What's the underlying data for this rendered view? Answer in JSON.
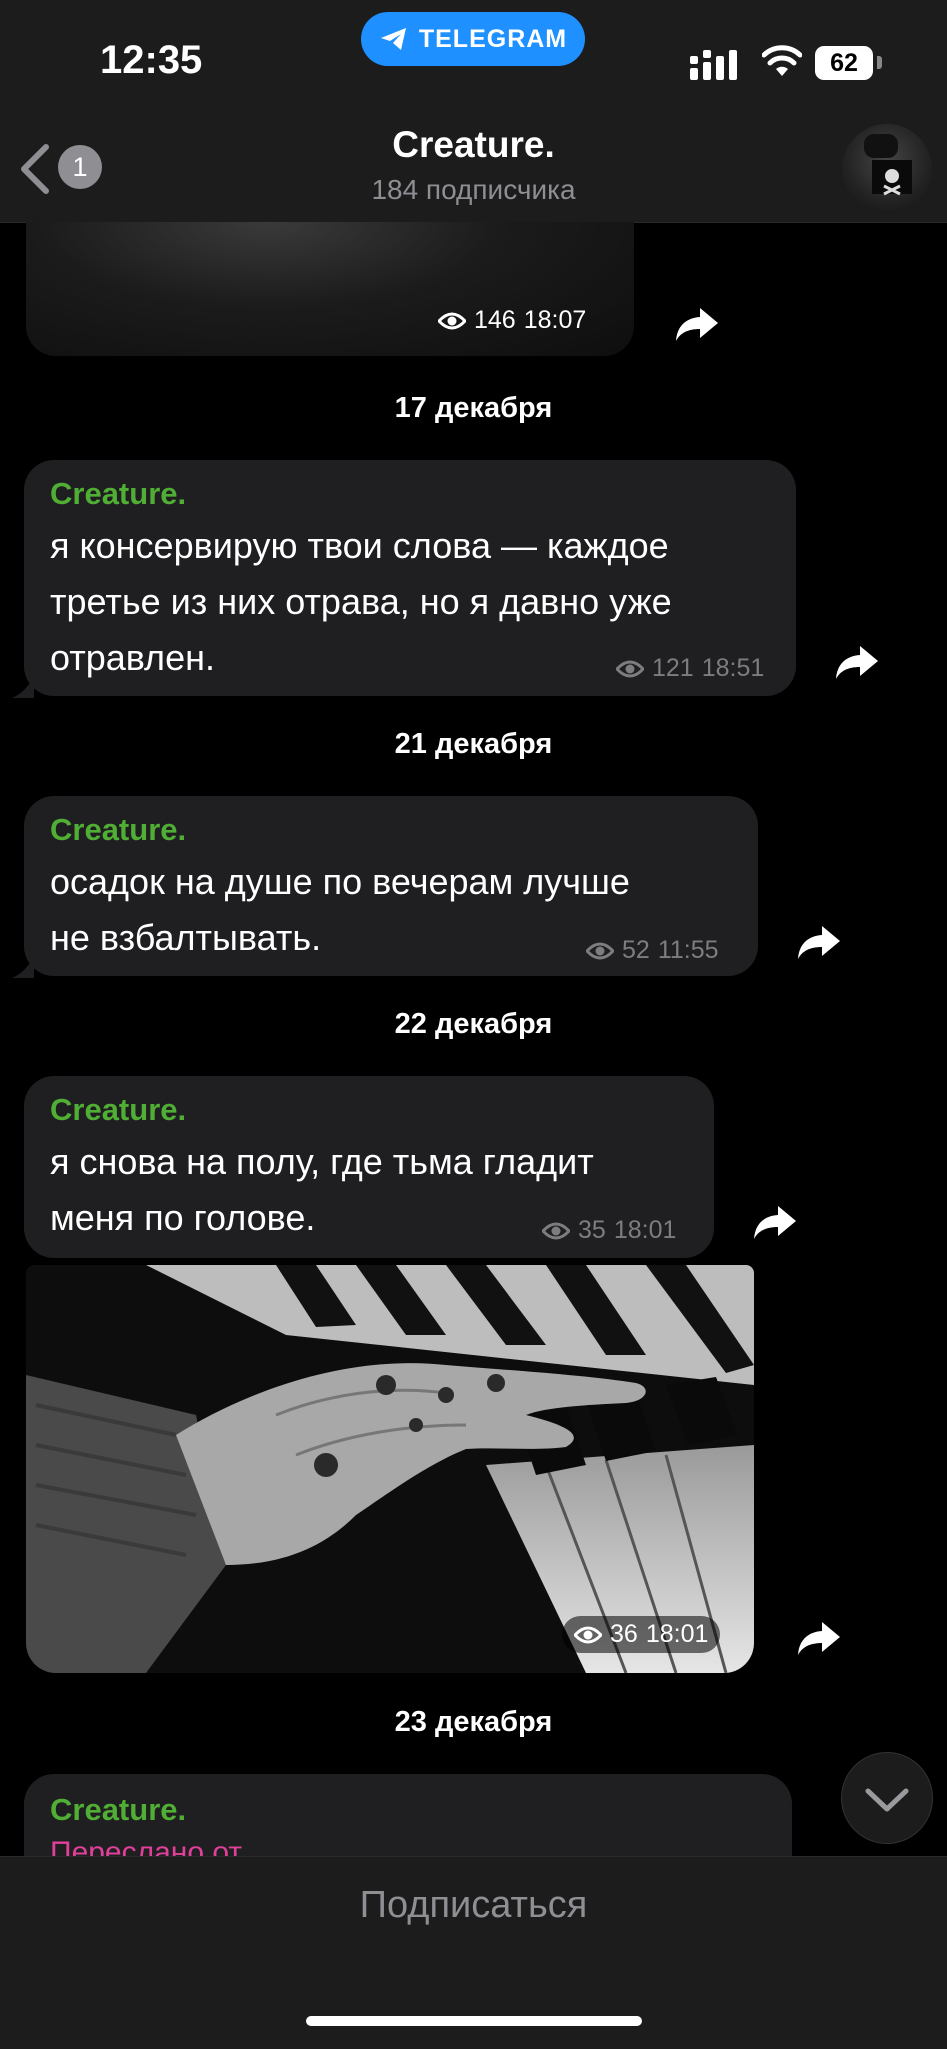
{
  "status_bar": {
    "time": "12:35",
    "app_pill": "TELEGRAM",
    "battery": "62"
  },
  "header": {
    "back_count": "1",
    "title": "Creature.",
    "subtitle": "184 подписчика"
  },
  "messages": [
    {
      "id": "m0",
      "type": "photo",
      "views": "146",
      "time": "18:07"
    },
    {
      "id": "d1",
      "type": "date",
      "text": "17 декабря"
    },
    {
      "id": "m1",
      "type": "text",
      "author": "Creature.",
      "lines": [
        "я консервирую твои слова — каждое",
        "третье из них отрава, но я давно уже",
        "отравлен."
      ],
      "views": "121",
      "time": "18:51"
    },
    {
      "id": "d2",
      "type": "date",
      "text": "21 декабря"
    },
    {
      "id": "m2",
      "type": "text",
      "author": "Creature.",
      "lines": [
        "осадок на душе по вечерам лучше",
        "не взбалтывать."
      ],
      "views": "52",
      "time": "11:55"
    },
    {
      "id": "d3",
      "type": "date",
      "text": "22 декабря"
    },
    {
      "id": "m3",
      "type": "text",
      "author": "Creature.",
      "lines": [
        "я снова на полу, где тьма гладит",
        "меня по голове."
      ],
      "views": "35",
      "time": "18:01"
    },
    {
      "id": "m4",
      "type": "photo",
      "views": "36",
      "time": "18:01"
    },
    {
      "id": "d4",
      "type": "date",
      "text": "23 декабря"
    },
    {
      "id": "m5",
      "type": "forward",
      "author": "Creature.",
      "forwarded_label": "Переслано от"
    }
  ],
  "footer": {
    "subscribe_label": "Подписаться"
  },
  "colors": {
    "author": "#4fae33",
    "bubble": "#1f1f21",
    "pill": "#1e90ff",
    "forward": "#e0409a"
  }
}
